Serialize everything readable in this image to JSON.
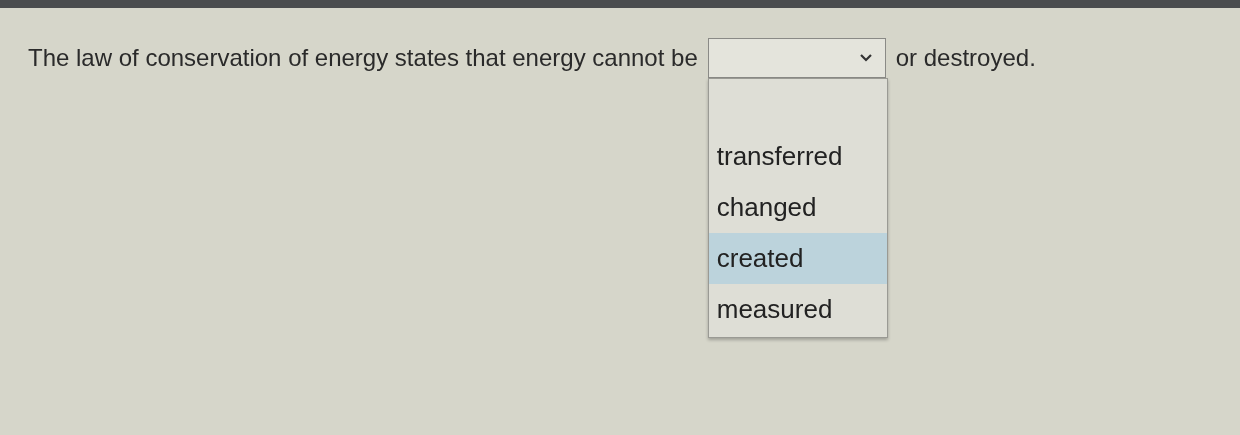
{
  "question": {
    "text_before": "The law of conservation of energy states that energy cannot be",
    "text_after": "or destroyed."
  },
  "dropdown": {
    "expanded": true,
    "options": [
      {
        "label": "transferred",
        "selected": false
      },
      {
        "label": "changed",
        "selected": false
      },
      {
        "label": "created",
        "selected": true
      },
      {
        "label": "measured",
        "selected": false
      }
    ]
  }
}
